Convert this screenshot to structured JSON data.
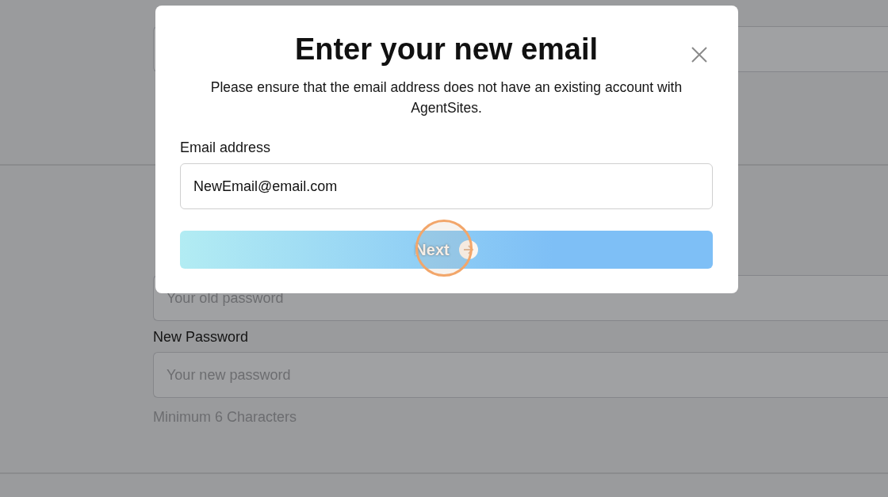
{
  "background_form": {
    "fields": [
      {
        "placeholder": "Your old password"
      },
      {
        "label": "New Password",
        "placeholder": "Your new password",
        "hint": "Minimum 6 Characters"
      }
    ]
  },
  "modal": {
    "title": "Enter your new email",
    "description": "Please ensure that the email address does not have an existing account with AgentSites.",
    "email_field": {
      "label": "Email address",
      "value": "NewEmail@email.com"
    },
    "next_button": {
      "label": "Next"
    }
  }
}
